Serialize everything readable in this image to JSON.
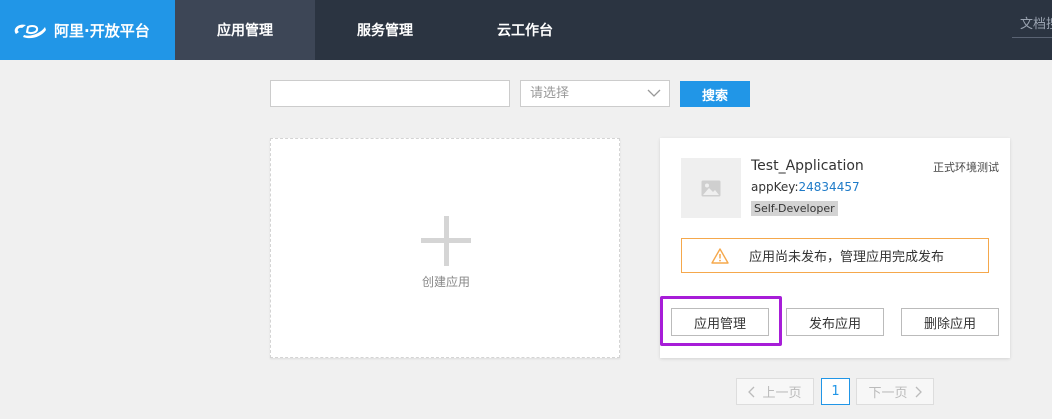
{
  "header": {
    "logo_text": "阿里·开放平台",
    "nav": [
      {
        "label": "应用管理",
        "active": true
      },
      {
        "label": "服务管理",
        "active": false
      },
      {
        "label": "云工作台",
        "active": false
      }
    ],
    "doc_search_text": "文档搜索"
  },
  "filters": {
    "search_value": "",
    "select_placeholder": "请选择",
    "search_button": "搜索"
  },
  "create_card": {
    "label": "创建应用"
  },
  "app_card": {
    "name": "Test_Application",
    "app_key_label": "appKey:",
    "app_key_value": "24834457",
    "badge": "Self-Developer",
    "env": "正式环境测试",
    "warning": "应用尚未发布，管理应用完成发布",
    "buttons": {
      "manage": "应用管理",
      "publish": "发布应用",
      "delete": "删除应用"
    }
  },
  "pagination": {
    "prev": "上一页",
    "current": "1",
    "next": "下一页"
  },
  "colors": {
    "brand": "#2196e7",
    "topbar": "#2b3441",
    "warning_border": "#f5a84c",
    "highlight": "#a71dd8"
  }
}
